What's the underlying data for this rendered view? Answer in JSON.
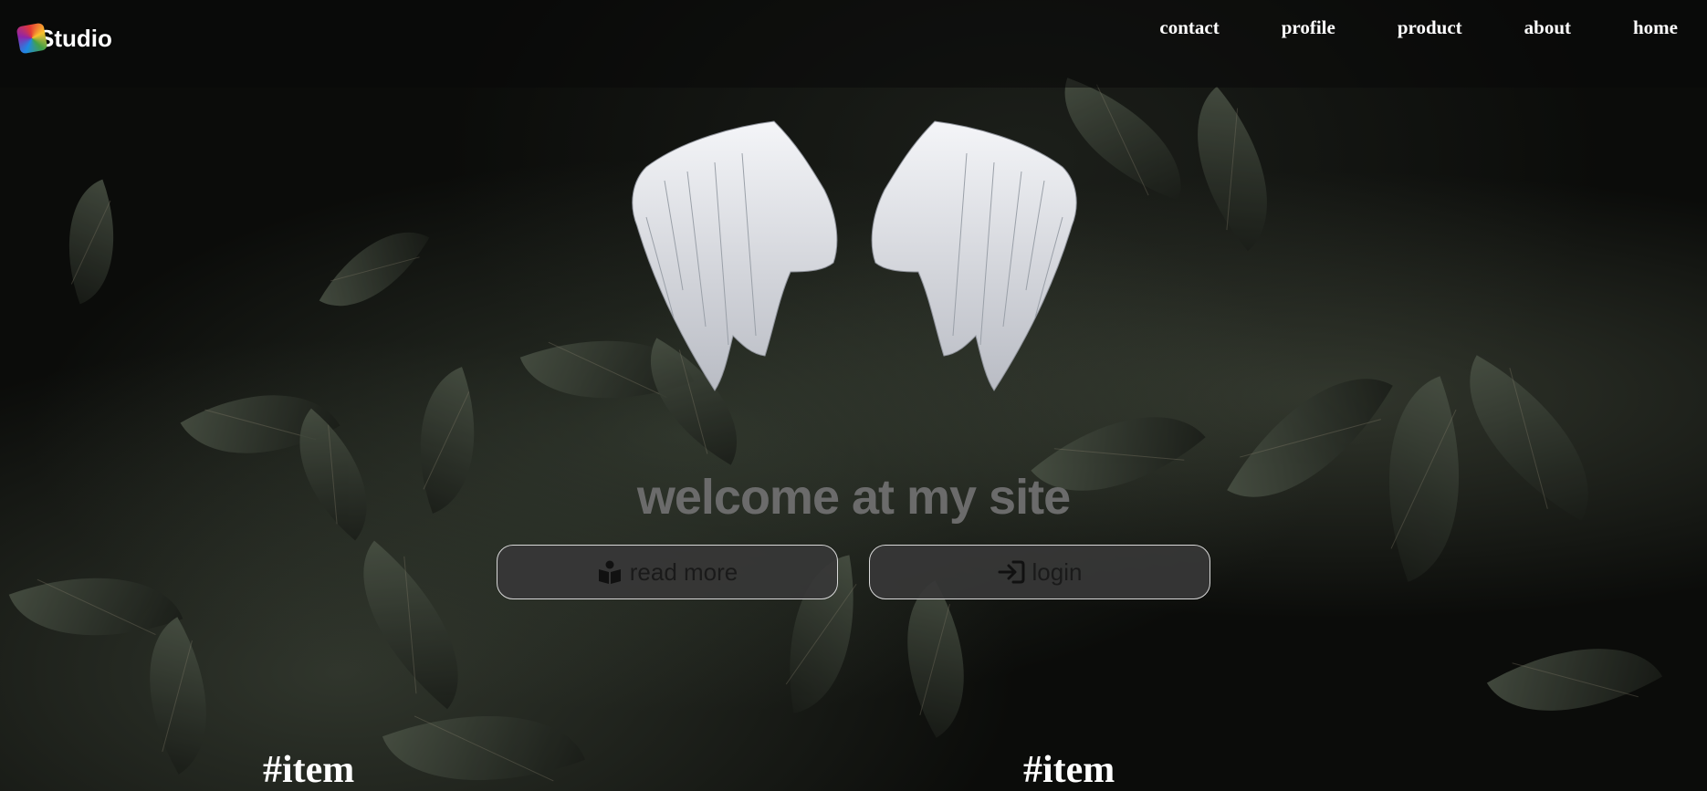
{
  "brand": {
    "logo_text": "Studio"
  },
  "nav": {
    "items": [
      {
        "label": "contact"
      },
      {
        "label": "profile"
      },
      {
        "label": "product"
      },
      {
        "label": "about"
      },
      {
        "label": "home"
      }
    ]
  },
  "hero": {
    "title": "welcome at my site",
    "read_more_label": "read more",
    "login_label": "login"
  },
  "sections": [
    {
      "heading": "#item"
    },
    {
      "heading": "#item"
    }
  ],
  "colors": {
    "hero_title": "#6b6b6b",
    "button_bg": "#373737",
    "button_border": "#d8d8d8",
    "nav_text": "#ffffff"
  },
  "icons": {
    "read_more": "book-reader-icon",
    "login": "sign-in-icon"
  }
}
